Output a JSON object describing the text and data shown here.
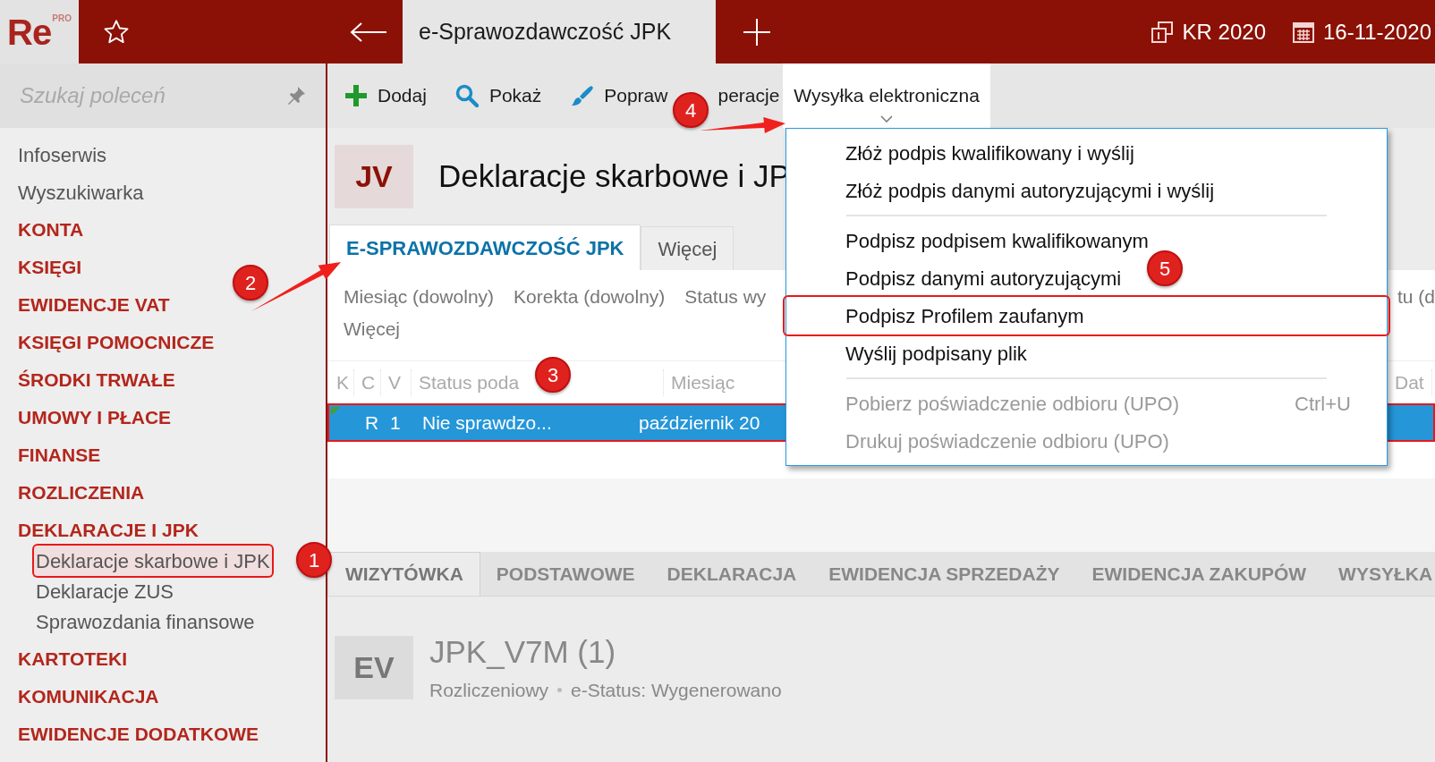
{
  "app": {
    "logo": "Re",
    "logo_badge": "PRO"
  },
  "top_bar": {
    "tab_title": "e-Sprawozdawczość JPK",
    "period": "KR 2020",
    "date": "16-11-2020"
  },
  "sidebar": {
    "search": {
      "placeholder": "Szukaj poleceń"
    },
    "items": [
      {
        "label": "Infoserwis",
        "kind": "link"
      },
      {
        "label": "Wyszukiwarka",
        "kind": "link"
      },
      {
        "label": "KONTA",
        "kind": "section"
      },
      {
        "label": "KSIĘGI",
        "kind": "section"
      },
      {
        "label": "EWIDENCJE VAT",
        "kind": "section"
      },
      {
        "label": "KSIĘGI POMOCNICZE",
        "kind": "section"
      },
      {
        "label": "ŚRODKI TRWAŁE",
        "kind": "section"
      },
      {
        "label": "UMOWY I PŁACE",
        "kind": "section"
      },
      {
        "label": "FINANSE",
        "kind": "section"
      },
      {
        "label": "ROZLICZENIA",
        "kind": "section"
      },
      {
        "label": "DEKLARACJE I JPK",
        "kind": "section",
        "children": [
          {
            "label": "Deklaracje skarbowe i JPK",
            "selected": true,
            "highlighted": true
          },
          {
            "label": "Deklaracje ZUS",
            "selected": false,
            "highlighted": false
          },
          {
            "label": "Sprawozdania finansowe",
            "selected": false,
            "highlighted": false
          }
        ]
      },
      {
        "label": "KARTOTEKI",
        "kind": "section"
      },
      {
        "label": "KOMUNIKACJA",
        "kind": "section"
      },
      {
        "label": "EWIDENCJE DODATKOWE",
        "kind": "section"
      }
    ]
  },
  "toolbar": {
    "buttons": [
      {
        "label": "Dodaj",
        "kind": "add",
        "expanded": false
      },
      {
        "label": "Pokaż",
        "kind": "show",
        "expanded": false
      },
      {
        "label": "Popraw",
        "kind": "edit",
        "expanded": false
      },
      {
        "label": "peracje",
        "kind": "menu",
        "expanded": false
      },
      {
        "label": "Wysyłka elektroniczna",
        "kind": "menu",
        "expanded": true
      }
    ]
  },
  "header": {
    "badge": "JV",
    "title": "Deklaracje skarbowe i JP"
  },
  "tabs": [
    {
      "label": "E-SPRAWOZDAWCZOŚĆ JPK",
      "selected": true
    },
    {
      "label": "Więcej",
      "selected": false
    }
  ],
  "filters": {
    "items": [
      "Miesiąc (dowolny)",
      "Korekta (dowolny)",
      "Status wy"
    ],
    "more": "Więcej",
    "right_fragment": "tu (d"
  },
  "table": {
    "columns": [
      "K",
      "C",
      "V",
      "Status poda",
      "Miesiąc",
      "Dat"
    ],
    "rows": [
      {
        "c": "R",
        "v": "1",
        "status": "Nie sprawdzo...",
        "month": "październik 20",
        "selected": true,
        "highlighted": true
      }
    ]
  },
  "dropdown_menu": {
    "items": [
      {
        "kind": "item",
        "label": "Złóż podpis kwalifikowany i wyślij",
        "disabled": false,
        "highlighted": false
      },
      {
        "kind": "item",
        "label": "Złóż podpis danymi autoryzującymi i wyślij",
        "disabled": false,
        "highlighted": false
      },
      {
        "kind": "separator"
      },
      {
        "kind": "item",
        "label": "Podpisz podpisem kwalifikowanym",
        "disabled": false,
        "highlighted": false
      },
      {
        "kind": "item",
        "label": "Podpisz danymi autoryzującymi",
        "disabled": false,
        "highlighted": false
      },
      {
        "kind": "item",
        "label": "Podpisz Profilem zaufanym",
        "disabled": false,
        "highlighted": true
      },
      {
        "kind": "item",
        "label": "Wyślij podpisany plik",
        "disabled": false,
        "highlighted": false
      },
      {
        "kind": "separator"
      },
      {
        "kind": "item",
        "label": "Pobierz poświadczenie odbioru (UPO)",
        "shortcut": "Ctrl+U",
        "disabled": true,
        "highlighted": false
      },
      {
        "kind": "item",
        "label": "Drukuj poświadczenie odbioru (UPO)",
        "disabled": true,
        "highlighted": false
      }
    ]
  },
  "detail_tabs": [
    {
      "label": "WIZYTÓWKA",
      "selected": true
    },
    {
      "label": "PODSTAWOWE",
      "selected": false
    },
    {
      "label": "DEKLARACJA",
      "selected": false
    },
    {
      "label": "EWIDENCJA SPRZEDAŻY",
      "selected": false
    },
    {
      "label": "EWIDENCJA ZAKUPÓW",
      "selected": false
    },
    {
      "label": "WYSYŁKA",
      "selected": false
    }
  ],
  "record": {
    "badge": "EV",
    "title": "JPK_V7M (1)",
    "subtitle": [
      "Rozliczeniowy",
      "e-Status: Wygenerowano"
    ]
  },
  "annotations": [
    {
      "number": "1",
      "arrow": false
    },
    {
      "number": "2",
      "arrow": true
    },
    {
      "number": "3",
      "arrow": false
    },
    {
      "number": "4",
      "arrow": true
    },
    {
      "number": "5",
      "arrow": false
    }
  ]
}
